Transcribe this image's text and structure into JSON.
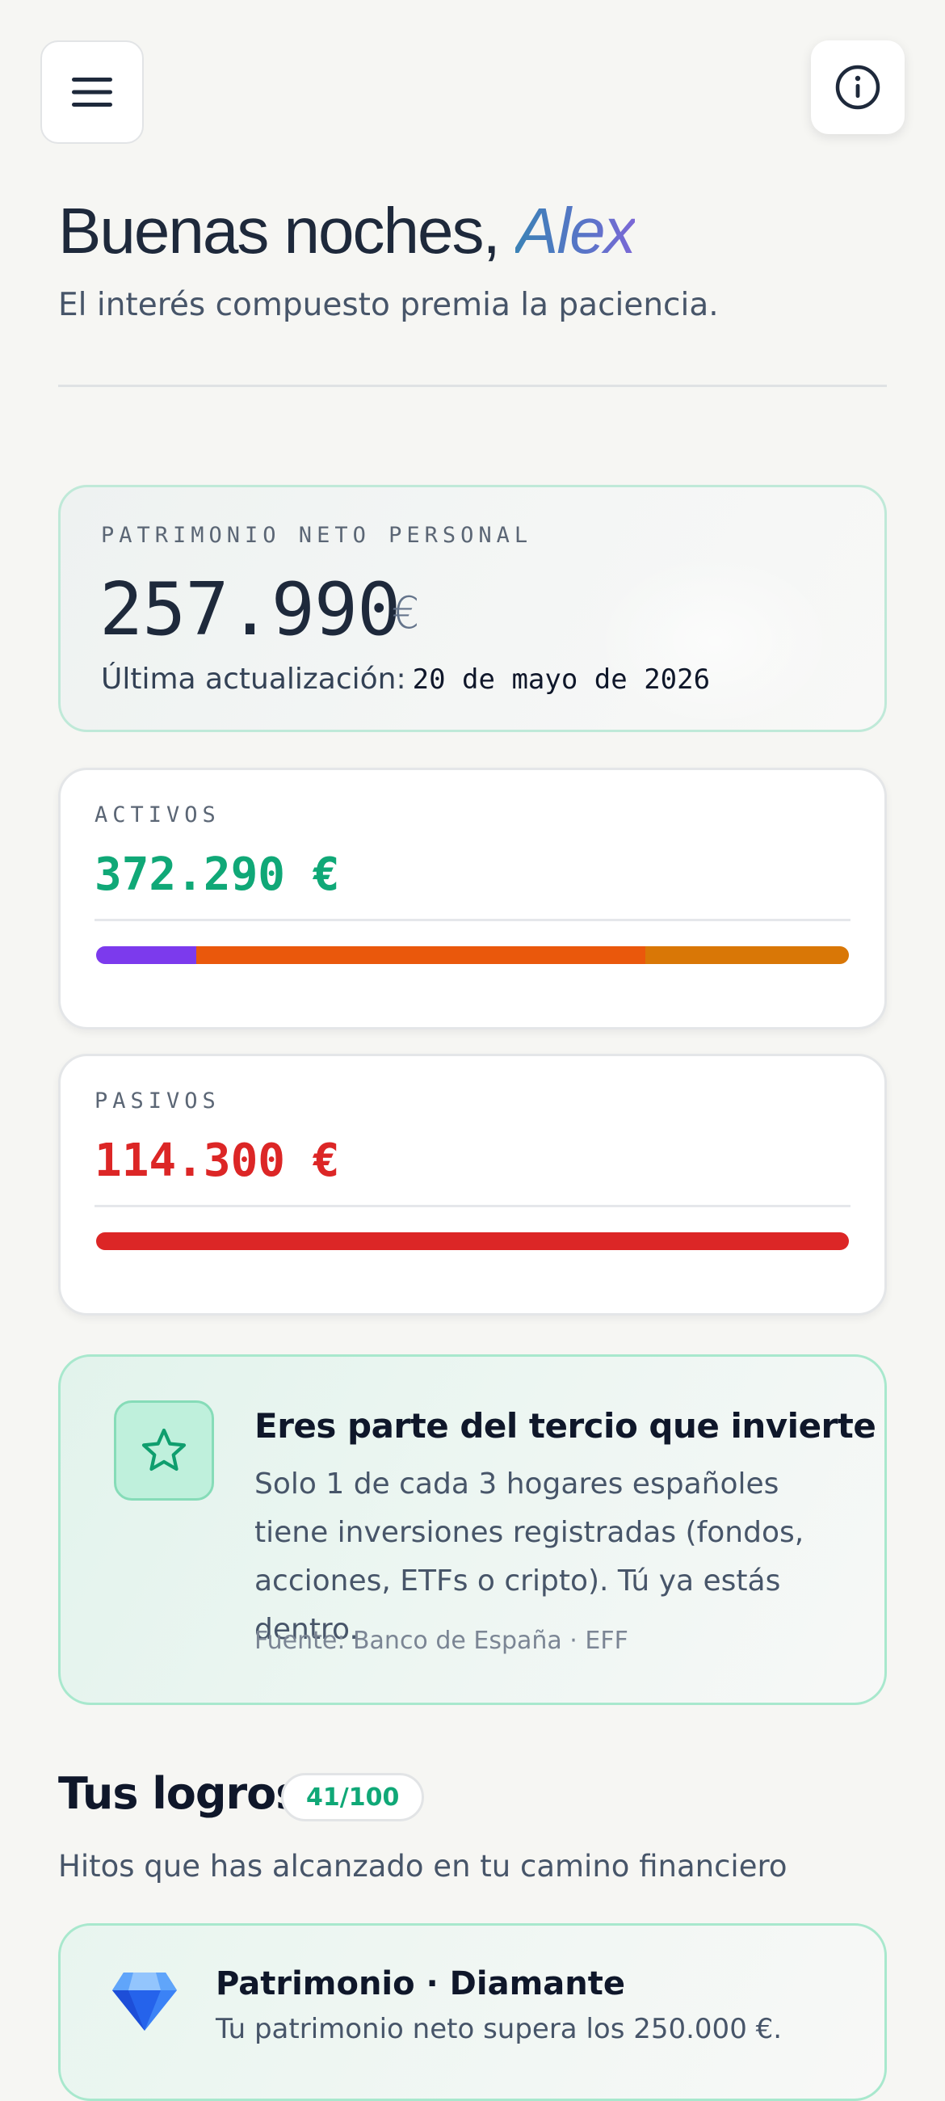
{
  "header": {
    "menu_icon": "hamburger-menu-icon",
    "info_icon": "info-circle-icon"
  },
  "greeting": {
    "prefix": "Buenas noches, ",
    "name": "Alex",
    "subtitle": "El interés compuesto premia la paciencia."
  },
  "net_worth": {
    "label": "PATRIMONIO NETO PERSONAL",
    "value": "257.990",
    "currency": "€",
    "updated_label": "Última actualización:",
    "updated_date": "20 de mayo de 2026"
  },
  "assets": {
    "label": "ACTIVOS",
    "value": "372.290 €",
    "color": "#10a877",
    "segments": [
      {
        "fraction": 0.133,
        "color": "#7c3aed"
      },
      {
        "fraction": 0.597,
        "color": "#ea580c"
      },
      {
        "fraction": 0.27,
        "color": "#d97706"
      }
    ]
  },
  "liabilities": {
    "label": "PASIVOS",
    "value": "114.300 €",
    "color": "#dc2626",
    "segments": [
      {
        "fraction": 1.0,
        "color": "#dc2626"
      }
    ]
  },
  "insight": {
    "icon": "star-icon",
    "title": "Eres parte del tercio que invierte",
    "body": "Solo 1 de cada 3 hogares españoles tiene inversiones registradas (fondos, acciones, ETFs o cripto). Tú ya estás dentro.",
    "source": "Fuente: Banco de España · EFF"
  },
  "achievements": {
    "title": "Tus logros",
    "count": "41/100",
    "subtitle": "Hitos que has alcanzado en tu camino financiero",
    "items": [
      {
        "icon": "diamond-icon",
        "name": "Patrimonio · Diamante",
        "description": "Tu patrimonio neto supera los 250.000 €."
      }
    ]
  },
  "colors": {
    "accent": "#10a877",
    "danger": "#dc2626",
    "text": "#1e293b"
  }
}
